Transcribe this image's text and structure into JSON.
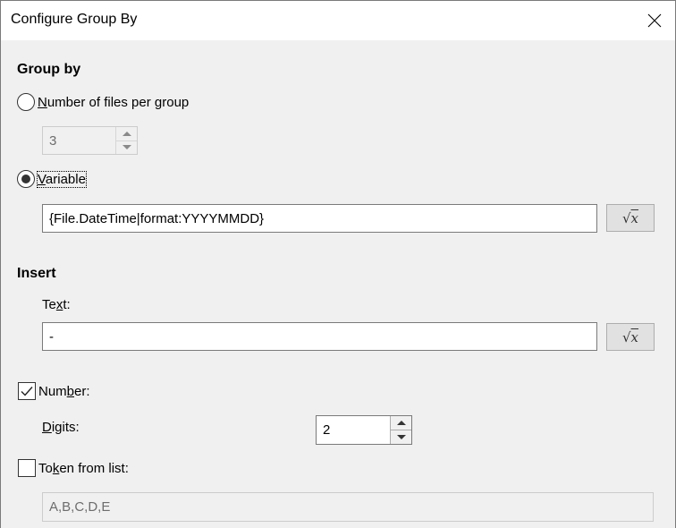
{
  "window": {
    "title": "Configure Group By",
    "close_icon": "close-x-icon"
  },
  "group_by": {
    "heading": "Group by",
    "option_number": {
      "label_mnemonic": "N",
      "label_rest": "umber of files per group",
      "selected": false,
      "spinner_value": "3",
      "spinner_enabled": false
    },
    "option_variable": {
      "label_mnemonic": "V",
      "label_rest": "ariable",
      "selected": true,
      "value": "{File.DateTime|format:YYYYMMDD}",
      "fx_button_icon": "square-root-x-icon"
    }
  },
  "insert": {
    "heading": "Insert",
    "text": {
      "label_pre": "Te",
      "label_mnemonic": "x",
      "label_post": "t:",
      "value": "-",
      "fx_button_icon": "square-root-x-icon"
    },
    "number": {
      "label_pre": "Num",
      "label_mnemonic": "b",
      "label_post": "er:",
      "checked": true,
      "digits_label_mnemonic": "D",
      "digits_label_rest": "igits:",
      "digits_value": "2"
    },
    "token": {
      "label_pre": "To",
      "label_mnemonic": "k",
      "label_post": "en from list:",
      "checked": false,
      "value": "A,B,C,D,E",
      "enabled": false
    }
  }
}
